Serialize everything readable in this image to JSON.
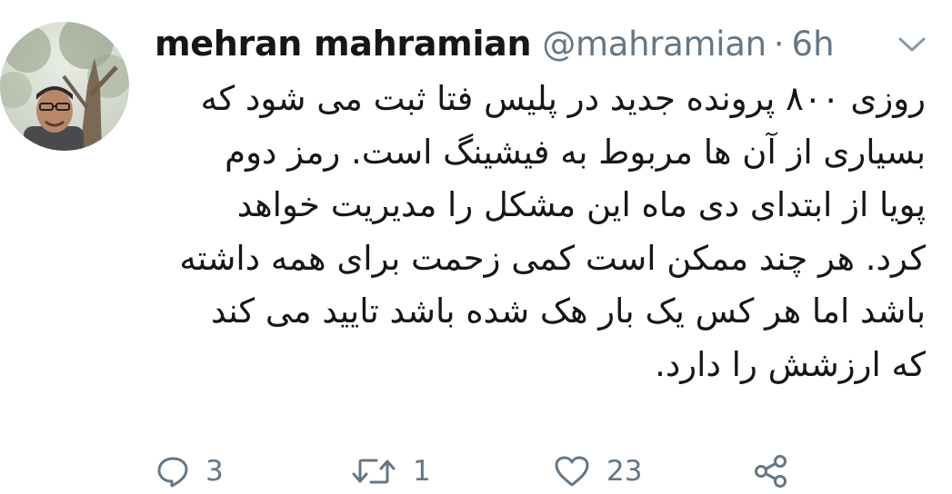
{
  "tweet": {
    "author_name": "mehran mahramian",
    "author_handle": "@mahramian",
    "separator": "·",
    "time_ago": "6h",
    "text_lines": [
      "روزی ۸۰۰ پرونده جدید در پلیس فتا ثبت می شود که",
      "بسیاری از آن ها مربوط به فیشینگ است. رمز دوم",
      "پویا از ابتدای دی ماه این مشکل را مدیریت خواهد",
      "کرد. هر چند ممکن است کمی زحمت برای همه داشته",
      "باشد اما هر کس یک بار هک شده باشد تایید می کند",
      "که ارزشش را دارد."
    ]
  },
  "actions": {
    "reply": {
      "icon": "reply-icon",
      "count": "3"
    },
    "retweet": {
      "icon": "retweet-icon",
      "count": "1"
    },
    "like": {
      "icon": "heart-icon",
      "count": "23"
    },
    "share": {
      "icon": "share-icon",
      "count": ""
    }
  },
  "colors": {
    "text": "#14171a",
    "secondary": "#657786",
    "background": "#ffffff"
  }
}
